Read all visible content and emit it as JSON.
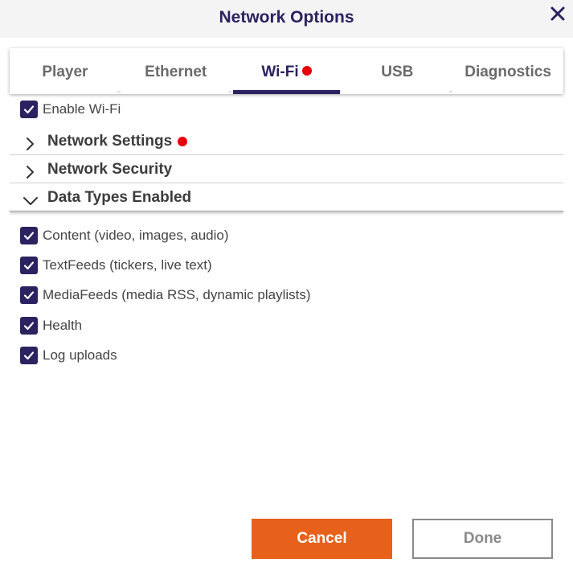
{
  "dialog": {
    "title": "Network Options",
    "close_icon": "close-icon"
  },
  "tabs": [
    {
      "label": "Player",
      "active": false,
      "alert": false
    },
    {
      "label": "Ethernet",
      "active": false,
      "alert": false
    },
    {
      "label": "Wi-Fi",
      "active": true,
      "alert": true
    },
    {
      "label": "USB",
      "active": false,
      "alert": false
    },
    {
      "label": "Diagnostics",
      "active": false,
      "alert": false
    }
  ],
  "enable_wifi": {
    "label": "Enable Wi-Fi",
    "checked": true
  },
  "sections": [
    {
      "title": "Network Settings",
      "expanded": false,
      "alert": true,
      "icon": "chevron-right-icon"
    },
    {
      "title": "Network Security",
      "expanded": false,
      "alert": false,
      "icon": "chevron-right-icon"
    },
    {
      "title": "Data Types Enabled",
      "expanded": true,
      "alert": false,
      "icon": "chevron-down-icon"
    }
  ],
  "data_types": [
    {
      "label": "Content (video, images, audio)",
      "checked": true
    },
    {
      "label": "TextFeeds (tickers, live text)",
      "checked": true
    },
    {
      "label": "MediaFeeds (media RSS, dynamic playlists)",
      "checked": true
    },
    {
      "label": "Health",
      "checked": true
    },
    {
      "label": "Log uploads",
      "checked": true
    }
  ],
  "buttons": {
    "cancel_label": "Cancel",
    "done_label": "Done"
  },
  "colors": {
    "primary": "#2b2260",
    "accent": "#e8611a",
    "alert": "#e8000b"
  }
}
